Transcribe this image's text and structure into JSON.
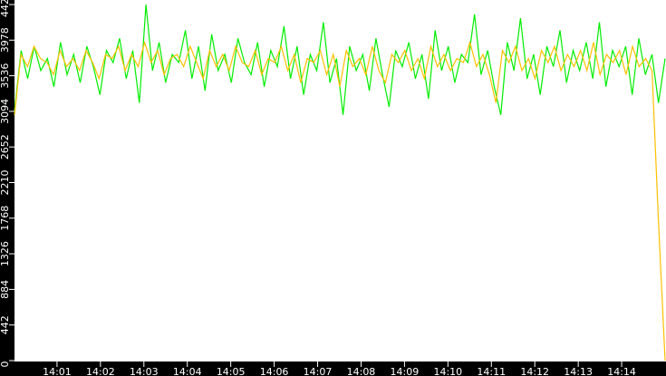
{
  "chart_data": {
    "type": "line",
    "title": "",
    "xlabel": "",
    "ylabel": "",
    "ylim": [
      0,
      4420
    ],
    "yticks": [
      "0",
      "442",
      "884",
      "1326",
      "1768",
      "2210",
      "2652",
      "3094",
      "3536",
      "3978",
      "4420"
    ],
    "xlim_minutes": [
      0,
      15
    ],
    "xticks": [
      "14:01",
      "14:02",
      "14:03",
      "14:04",
      "14:05",
      "14:06",
      "14:07",
      "14:08",
      "14:09",
      "14:10",
      "14:11",
      "14:12",
      "14:13",
      "14:14"
    ],
    "grid": false,
    "colors": {
      "background": "#ffffff",
      "axis": "#000000",
      "green": "#00ee00",
      "yellow": "#ffc000"
    },
    "series": [
      {
        "name": "green",
        "color": "#00ee00",
        "values": [
          3100,
          3850,
          3500,
          3900,
          3600,
          3750,
          3400,
          3950,
          3550,
          3800,
          3450,
          3900,
          3650,
          3300,
          3850,
          3700,
          4000,
          3500,
          3850,
          3200,
          4420,
          3600,
          3950,
          3450,
          3800,
          3700,
          4100,
          3500,
          3900,
          3350,
          4050,
          3600,
          3800,
          3450,
          4000,
          3700,
          3550,
          3950,
          3400,
          3850,
          3650,
          4150,
          3500,
          3900,
          3300,
          3800,
          3600,
          4200,
          3450,
          3750,
          3050,
          3900,
          3600,
          3800,
          3350,
          4000,
          3550,
          3150,
          3850,
          3650,
          3950,
          3500,
          3800,
          3250,
          4100,
          3600,
          3900,
          3450,
          3800,
          3700,
          4300,
          3550,
          3850,
          3400,
          3050,
          3950,
          3600,
          4250,
          3500,
          3800,
          3300,
          3900,
          3650,
          4100,
          3450,
          3850,
          3600,
          3950,
          3500,
          4200,
          3400,
          3850,
          3650,
          3900,
          3300,
          4000,
          3550,
          3800,
          3200,
          3750
        ]
      },
      {
        "name": "yellow",
        "color": "#ffc000",
        "values": [
          3050,
          3800,
          3650,
          3900,
          3750,
          3700,
          3550,
          3850,
          3650,
          3750,
          3600,
          3850,
          3700,
          3500,
          3800,
          3750,
          3900,
          3600,
          3800,
          3650,
          3950,
          3700,
          3850,
          3550,
          3750,
          3800,
          3650,
          3900,
          3700,
          3500,
          3850,
          3650,
          3800,
          3600,
          3900,
          3700,
          3650,
          3850,
          3550,
          3750,
          3700,
          3900,
          3600,
          3800,
          3450,
          3750,
          3700,
          3850,
          3550,
          3800,
          3400,
          3850,
          3650,
          3750,
          3550,
          3900,
          3600,
          3450,
          3800,
          3700,
          3850,
          3600,
          3750,
          3500,
          3900,
          3650,
          3800,
          3600,
          3750,
          3700,
          3950,
          3650,
          3800,
          3550,
          3200,
          3850,
          3700,
          3900,
          3600,
          3750,
          3500,
          3850,
          3700,
          3900,
          3600,
          3800,
          3650,
          3850,
          3600,
          3950,
          3550,
          3800,
          3700,
          3850,
          3550,
          3900,
          3650,
          3750,
          3600,
          1700,
          0
        ]
      }
    ]
  }
}
